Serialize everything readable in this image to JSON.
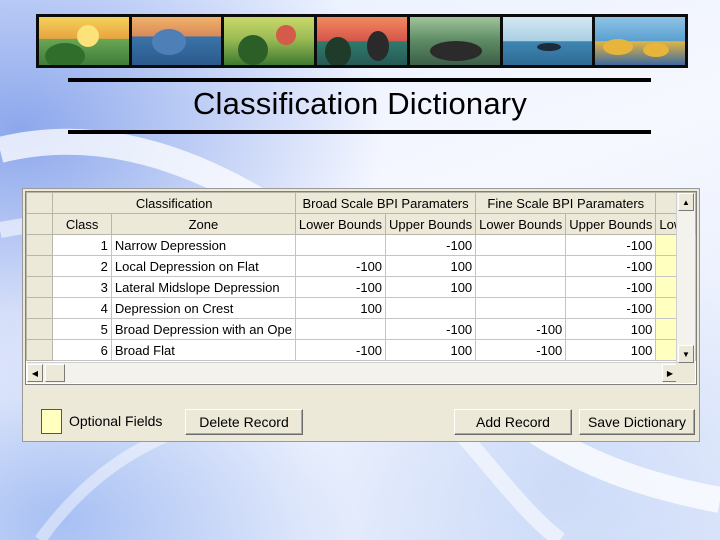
{
  "slide": {
    "title": "Classification Dictionary"
  },
  "grid": {
    "group_headers": {
      "classification": "Classification",
      "broad": "Broad Scale BPI Paramaters",
      "fine": "Fine Scale BPI Paramaters"
    },
    "columns": {
      "class": "Class",
      "zone": "Zone",
      "broad_lower": "Lower Bounds",
      "broad_upper": "Upper Bounds",
      "fine_lower": "Lower Bounds",
      "fine_upper": "Upper Bounds",
      "extra": "Lowe"
    },
    "rows": [
      {
        "class": "1",
        "zone": "Narrow Depression",
        "broad_lower": "",
        "broad_upper": "-100",
        "fine_lower": "",
        "fine_upper": "-100"
      },
      {
        "class": "2",
        "zone": "Local Depression on Flat",
        "broad_lower": "-100",
        "broad_upper": "100",
        "fine_lower": "",
        "fine_upper": "-100"
      },
      {
        "class": "3",
        "zone": "Lateral Midslope Depression",
        "broad_lower": "-100",
        "broad_upper": "100",
        "fine_lower": "",
        "fine_upper": "-100"
      },
      {
        "class": "4",
        "zone": "Depression on Crest",
        "broad_lower": "100",
        "broad_upper": "",
        "fine_lower": "",
        "fine_upper": "-100"
      },
      {
        "class": "5",
        "zone": "Broad Depression with an Ope",
        "broad_lower": "",
        "broad_upper": "-100",
        "fine_lower": "-100",
        "fine_upper": "100"
      },
      {
        "class": "6",
        "zone": "Broad Flat",
        "broad_lower": "-100",
        "broad_upper": "100",
        "fine_lower": "-100",
        "fine_upper": "100"
      }
    ]
  },
  "legend": {
    "label": "Optional Fields",
    "color": "#ffffc0"
  },
  "buttons": {
    "delete": "Delete Record",
    "add": "Add Record",
    "save": "Save Dictionary"
  },
  "icons": {
    "scroll_up": "▲",
    "scroll_down": "▼",
    "scroll_left": "◀",
    "scroll_right": "▶"
  }
}
